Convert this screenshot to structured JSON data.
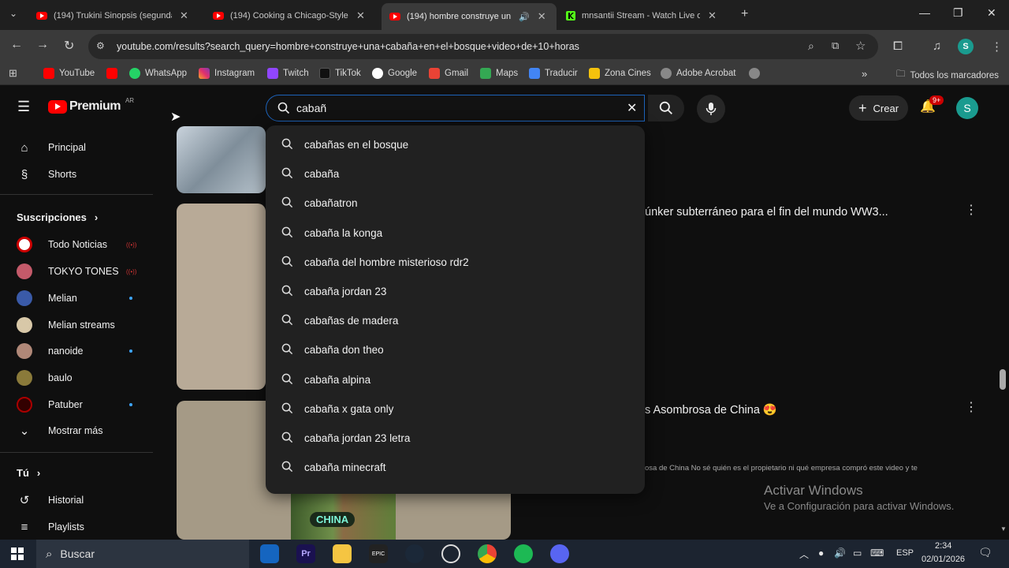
{
  "browser": {
    "tabs": [
      {
        "title": "(194) Trukini Sinopsis (segunda",
        "active": false
      },
      {
        "title": "(194) Cooking a Chicago-Style",
        "active": false
      },
      {
        "title": "(194) hombre construye un",
        "active": true
      },
      {
        "title": "mnsantii Stream - Watch Live o",
        "active": false
      }
    ],
    "url": "youtube.com/results?search_query=hombre+construye+una+cabaña+en+el+bosque+video+de+10+horas",
    "bookmarks": [
      "YouTube",
      "WhatsApp",
      "Instagram",
      "Twitch",
      "TikTok",
      "Google",
      "Gmail",
      "Maps",
      "Traducir",
      "Zona Cines",
      "Adobe Acrobat"
    ],
    "all_bookmarks": "Todos los marcadores",
    "profile_initial": "S"
  },
  "youtube": {
    "logo_text": "Premium",
    "country": "AR",
    "search_value": "cabañ",
    "create_label": "Crear",
    "notif_count": "9+",
    "avatar_initial": "S",
    "suggestions": [
      "cabañas en el bosque",
      "cabaña",
      "cabañatron",
      "cabaña la konga",
      "cabaña del hombre misterioso rdr2",
      "cabaña jordan 23",
      "cabañas de madera",
      "cabaña don theo",
      "cabaña alpina",
      "cabaña x gata only",
      "cabaña jordan 23 letra",
      "cabaña minecraft"
    ],
    "sidebar": {
      "principal": "Principal",
      "shorts": "Shorts",
      "subscriptions_heading": "Suscripciones",
      "channels": [
        {
          "name": "Todo Noticias",
          "live": true
        },
        {
          "name": "TOKYO TONES",
          "live": true
        },
        {
          "name": "Melian",
          "dot": true
        },
        {
          "name": "Melian streams"
        },
        {
          "name": "nanoide",
          "dot": true
        },
        {
          "name": "baulo"
        },
        {
          "name": "Patuber",
          "dot": true
        }
      ],
      "show_more": "Mostrar más",
      "you_heading": "Tú",
      "history": "Historial",
      "playlists": "Playlists"
    },
    "videos": [
      {
        "title_visible": "únker subterráneo para el fin del mundo WW3..."
      },
      {
        "title_visible": "s Asombrosa de China 😍",
        "desc_visible": "osa de China No sé quién es el propietario ni qué empresa compró este video y te"
      }
    ],
    "thumb_caption": "CHINA"
  },
  "watermark": {
    "line1": "Activar Windows",
    "line2": "Ve a Configuración para activar Windows."
  },
  "taskbar": {
    "search": "Buscar",
    "lang": "ESP",
    "time": "2:34",
    "date": "02/01/2026"
  }
}
